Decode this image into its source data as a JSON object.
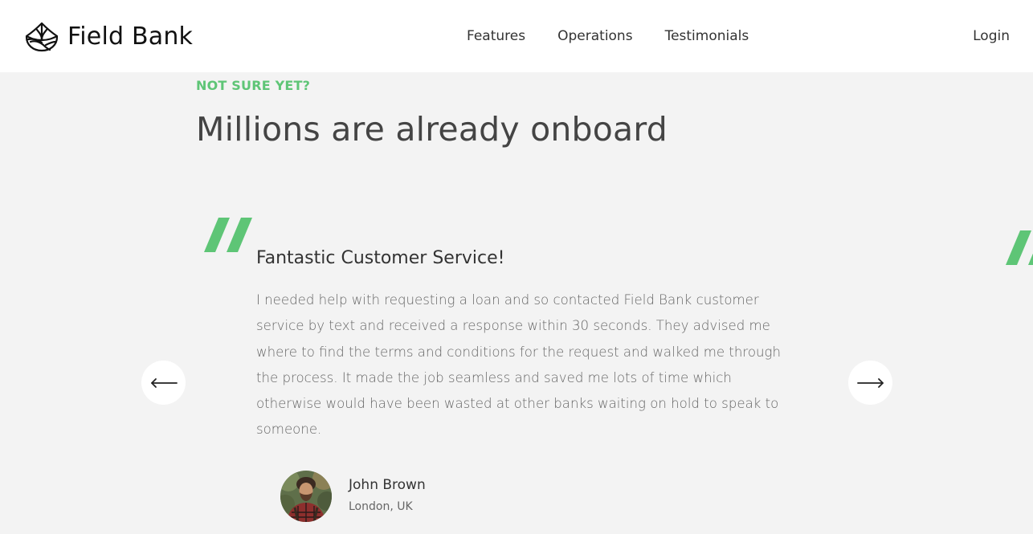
{
  "nav": {
    "brand": "Field Bank",
    "links": [
      "Features",
      "Operations",
      "Testimonials"
    ],
    "login": "Login"
  },
  "section": {
    "eyebrow": "NOT SURE YET?",
    "headline": "Millions are already onboard"
  },
  "testimonial": {
    "title": "Fantastic Customer Service!",
    "text": "I needed help with requesting a loan and so contacted Field Bank customer service by text and received a response within 30 seconds. They advised me where to find the terms and conditions for the request and walked me through the process. It made the job seamless and saved me lots of time which otherwise would have been wasted at other banks waiting on hold to speak to someone.",
    "author_name": "John Brown",
    "author_location": "London, UK"
  },
  "icons": {
    "logo": "field-bank-logo-icon",
    "quote": "quote-mark-icon",
    "left_arrow": "arrow-left-icon",
    "right_arrow": "arrow-right-icon"
  },
  "colors": {
    "accent": "#5ec576",
    "background": "#f3f3f3",
    "nav_background": "#ffffff",
    "text_dark": "#444444"
  }
}
